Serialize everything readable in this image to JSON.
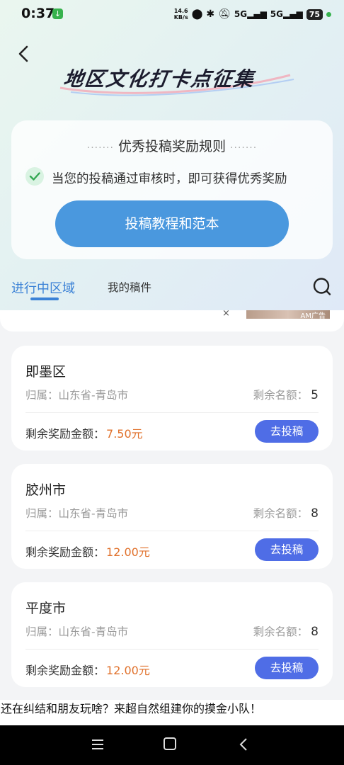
{
  "status_bar": {
    "time": "0:37",
    "net_speed_value": "14.6",
    "net_speed_unit": "KB/s",
    "signal1": "5G",
    "signal2": "5G",
    "battery": "75"
  },
  "header": {
    "title": "地区文化打卡点征集"
  },
  "rules": {
    "heading": "优秀投稿奖励规则",
    "item": "当您的投稿通过审核时，即可获得优秀奖励",
    "tutorial_button": "投稿教程和范本"
  },
  "tabs": {
    "active": "进行中区域",
    "other": "我的稿件"
  },
  "ad": {
    "close": "×",
    "label": "AM广告"
  },
  "cards": [
    {
      "name": "即墨区",
      "region_label": "归属：",
      "region": "山东省-青岛市",
      "quota_label": "剩余名额：",
      "quota": "5",
      "reward_label": "剩余奖励金额：",
      "reward": "7.50元",
      "button": "去投稿"
    },
    {
      "name": "胶州市",
      "region_label": "归属：",
      "region": "山东省-青岛市",
      "quota_label": "剩余名额：",
      "quota": "8",
      "reward_label": "剩余奖励金额：",
      "reward": "12.00元",
      "button": "去投稿"
    },
    {
      "name": "平度市",
      "region_label": "归属：",
      "region": "山东省-青岛市",
      "quota_label": "剩余名额：",
      "quota": "8",
      "reward_label": "剩余奖励金额：",
      "reward": "12.00元",
      "button": "去投稿"
    }
  ],
  "promo": {
    "text": "还在纠结和朋友玩啥？来超自然组建你的摸金小队！"
  },
  "colors": {
    "accent_blue": "#4a98de",
    "tab_blue": "#3b82d6",
    "submit_button": "#4f6de6",
    "reward_orange": "#e0702a"
  }
}
